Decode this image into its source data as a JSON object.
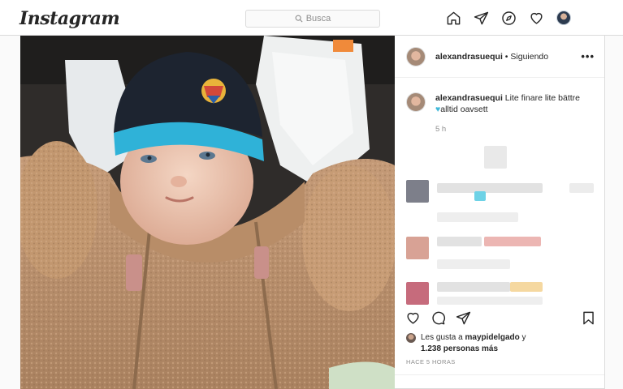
{
  "app": {
    "logo_text": "Instagram"
  },
  "search": {
    "placeholder": "Busca"
  },
  "nav": {
    "icons": [
      "home-icon",
      "direct-icon",
      "explore-icon",
      "activity-heart-icon",
      "profile-avatar"
    ]
  },
  "post": {
    "username": "alexandrasuequi",
    "follow_status": "• Siguiendo",
    "more_label": "•••",
    "caption_user": "alexandrasuequi",
    "caption_text": "Lite finare lite bättre",
    "caption_heart": "♥",
    "caption_text_2": "alltid oavsett",
    "caption_time": "5 h",
    "likes_prefix": "Les gusta a ",
    "likes_user": "maypidelgado",
    "likes_suffix": " y",
    "likes_count": "1.238 personas más",
    "timestamp": "HACE 5 HORAS"
  },
  "colors": {
    "accent_heart": "#3fb8d9",
    "border": "#dbdbdb",
    "muted": "#8e8e8e"
  }
}
